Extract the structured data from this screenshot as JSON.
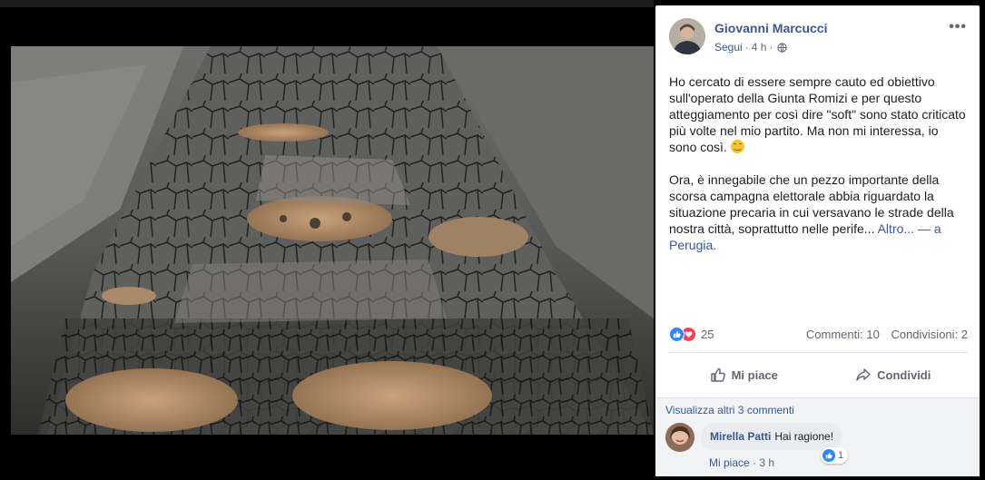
{
  "post": {
    "author": "Giovanni Marcucci",
    "follow_label": "Segui",
    "separator": "·",
    "time": "4 h",
    "privacy_icon": "globe-icon",
    "options_icon": "more-options-icon",
    "paragraph1": "Ho cercato di essere sempre cauto ed obiettivo sull'operato della Giunta Romizi e per questo atteggiamento per così dire \"soft\" sono stato criticato più volte nel mio partito. Ma non mi interessa, io sono così.",
    "paragraph2_text": "Ora, è innegabile che un pezzo importante della scorsa campagna elettorale abbia riguardato la situazione precaria in cui versavano le strade della nostra città, soprattutto nelle perife...",
    "more_label": "Altro...",
    "location_prefix": "— a",
    "location": "Perugia."
  },
  "stats": {
    "reaction_count": "25",
    "comments": "Commenti: 10",
    "shares": "Condivisioni: 2"
  },
  "actions": {
    "like": "Mi piace",
    "share": "Condividi"
  },
  "comments": {
    "view_more": "Visualizza altri 3 commenti",
    "items": [
      {
        "author": "Mirella Patti",
        "text": "Hai ragione!",
        "like_count": "1",
        "like_action": "Mi piace",
        "separator": "·",
        "time": "3 h"
      }
    ]
  },
  "colors": {
    "link": "#385898",
    "like_blue": "#2d88ff",
    "love_red": "#f33e58"
  }
}
